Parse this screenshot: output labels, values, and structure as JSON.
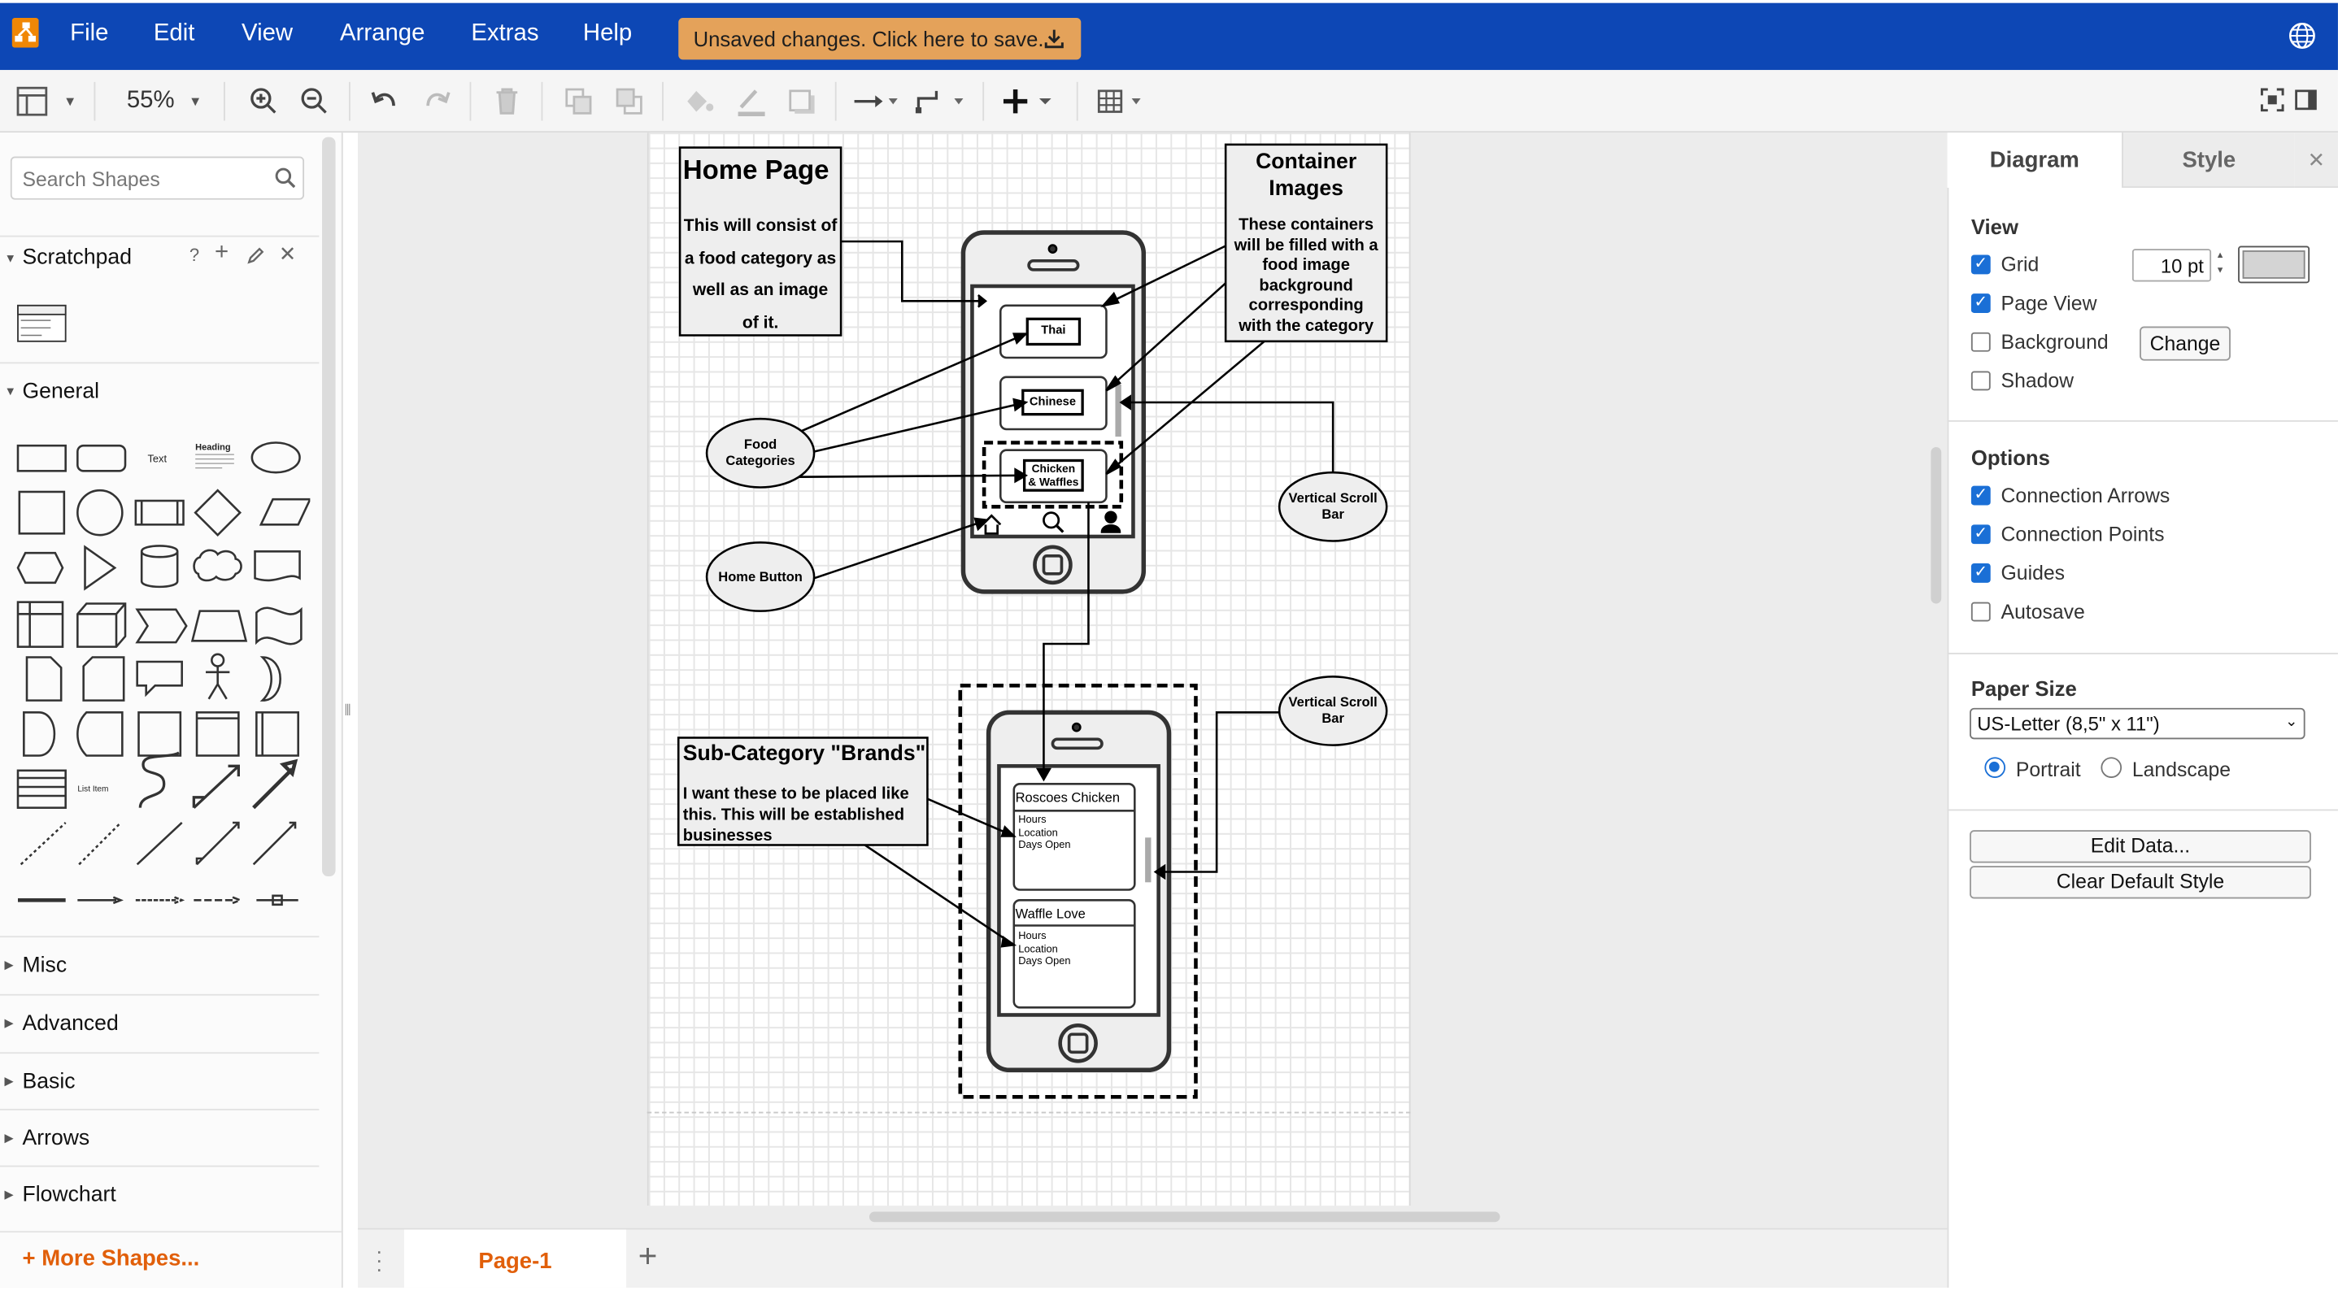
{
  "menu": {
    "file": "File",
    "edit": "Edit",
    "view": "View",
    "arrange": "Arrange",
    "extras": "Extras",
    "help": "Help",
    "save_banner": "Unsaved changes. Click here to save."
  },
  "toolbar": {
    "zoom": "55%"
  },
  "sidebar": {
    "search_placeholder": "Search Shapes",
    "scratchpad": "Scratchpad",
    "general": "General",
    "shape_text": "Text",
    "shape_heading": "Heading",
    "shape_listitem": "List Item",
    "sections": [
      "Misc",
      "Advanced",
      "Basic",
      "Arrows",
      "Flowchart"
    ],
    "more_shapes": "More Shapes..."
  },
  "pages": {
    "tab": "Page-1"
  },
  "format_panel": {
    "tab_diagram": "Diagram",
    "tab_style": "Style",
    "view_title": "View",
    "grid": "Grid",
    "grid_size": "10 pt",
    "grid_color": "#d4d4d4",
    "page_view": "Page View",
    "background": "Background",
    "change": "Change",
    "shadow": "Shadow",
    "options_title": "Options",
    "connection_arrows": "Connection Arrows",
    "connection_points": "Connection Points",
    "guides": "Guides",
    "autosave": "Autosave",
    "paper_title": "Paper Size",
    "paper_value": "US-Letter (8,5\" x 11\")",
    "portrait": "Portrait",
    "landscape": "Landscape",
    "edit_data": "Edit Data...",
    "clear_style": "Clear Default Style"
  },
  "diagram": {
    "home_title": "Home Page",
    "home_lines": [
      "This will consist of",
      "a food category as",
      "well as an image",
      "of it."
    ],
    "container_title_1": "Container",
    "container_title_2": "Images",
    "container_lines": [
      "These containers",
      "will be filled with a",
      "food image",
      "background",
      "corresponding",
      "with the category"
    ],
    "thai": "Thai",
    "chinese": "Chinese",
    "chicken_1": "Chicken",
    "chicken_2": "& Waffles",
    "food_1": "Food",
    "food_2": "Categories",
    "home_button": "Home Button",
    "vscroll_1": "Vertical Scroll",
    "vscroll_2": "Bar",
    "sub_title": "Sub-Category \"Brands\"",
    "sub_lines": [
      "I want these to be placed like",
      "this. This will be established",
      "businesses"
    ],
    "card1_title": "Roscoes Chicken",
    "card2_title": "Waffle Love",
    "card_lines": [
      "Hours",
      "Location",
      "Days Open"
    ]
  }
}
